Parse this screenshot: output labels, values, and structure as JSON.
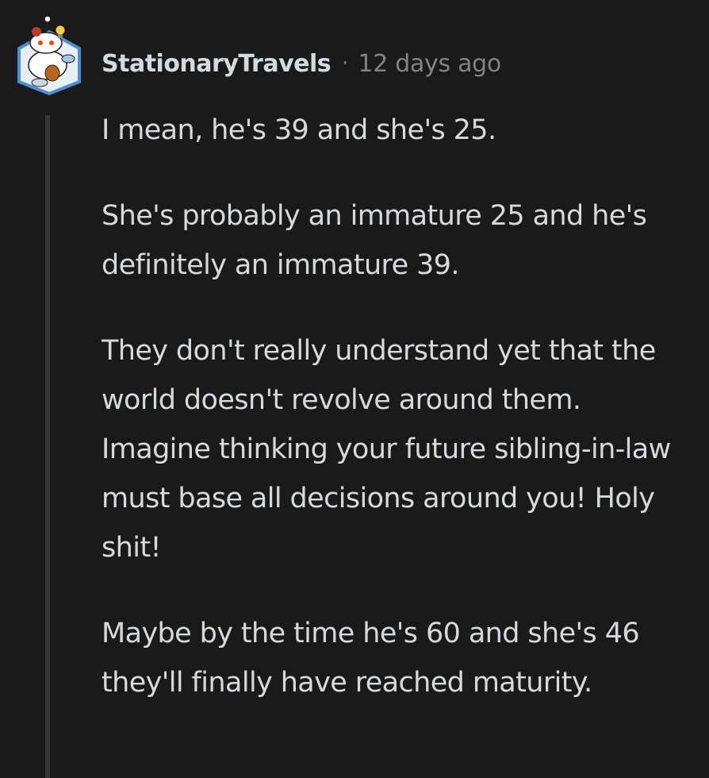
{
  "comment": {
    "author": "StationaryTravels",
    "separator": "·",
    "timestamp": "12 days ago",
    "avatar_icon": "snoo-avatar-icon",
    "paragraphs": [
      "I mean, he's 39 and she's 25.",
      "She's probably an immature 25 and he's definitely an immature 39.",
      "They don't really understand yet that the world doesn't revolve around them. Imagine thinking your future sibling-in-law must base all decisions around you! Holy shit!",
      "Maybe by the time he's 60 and she's 46 they'll finally have reached maturity."
    ]
  },
  "colors": {
    "background": "#1a1a1b",
    "text": "#d7dadc",
    "meta": "#818384",
    "thread_line": "#343536"
  }
}
